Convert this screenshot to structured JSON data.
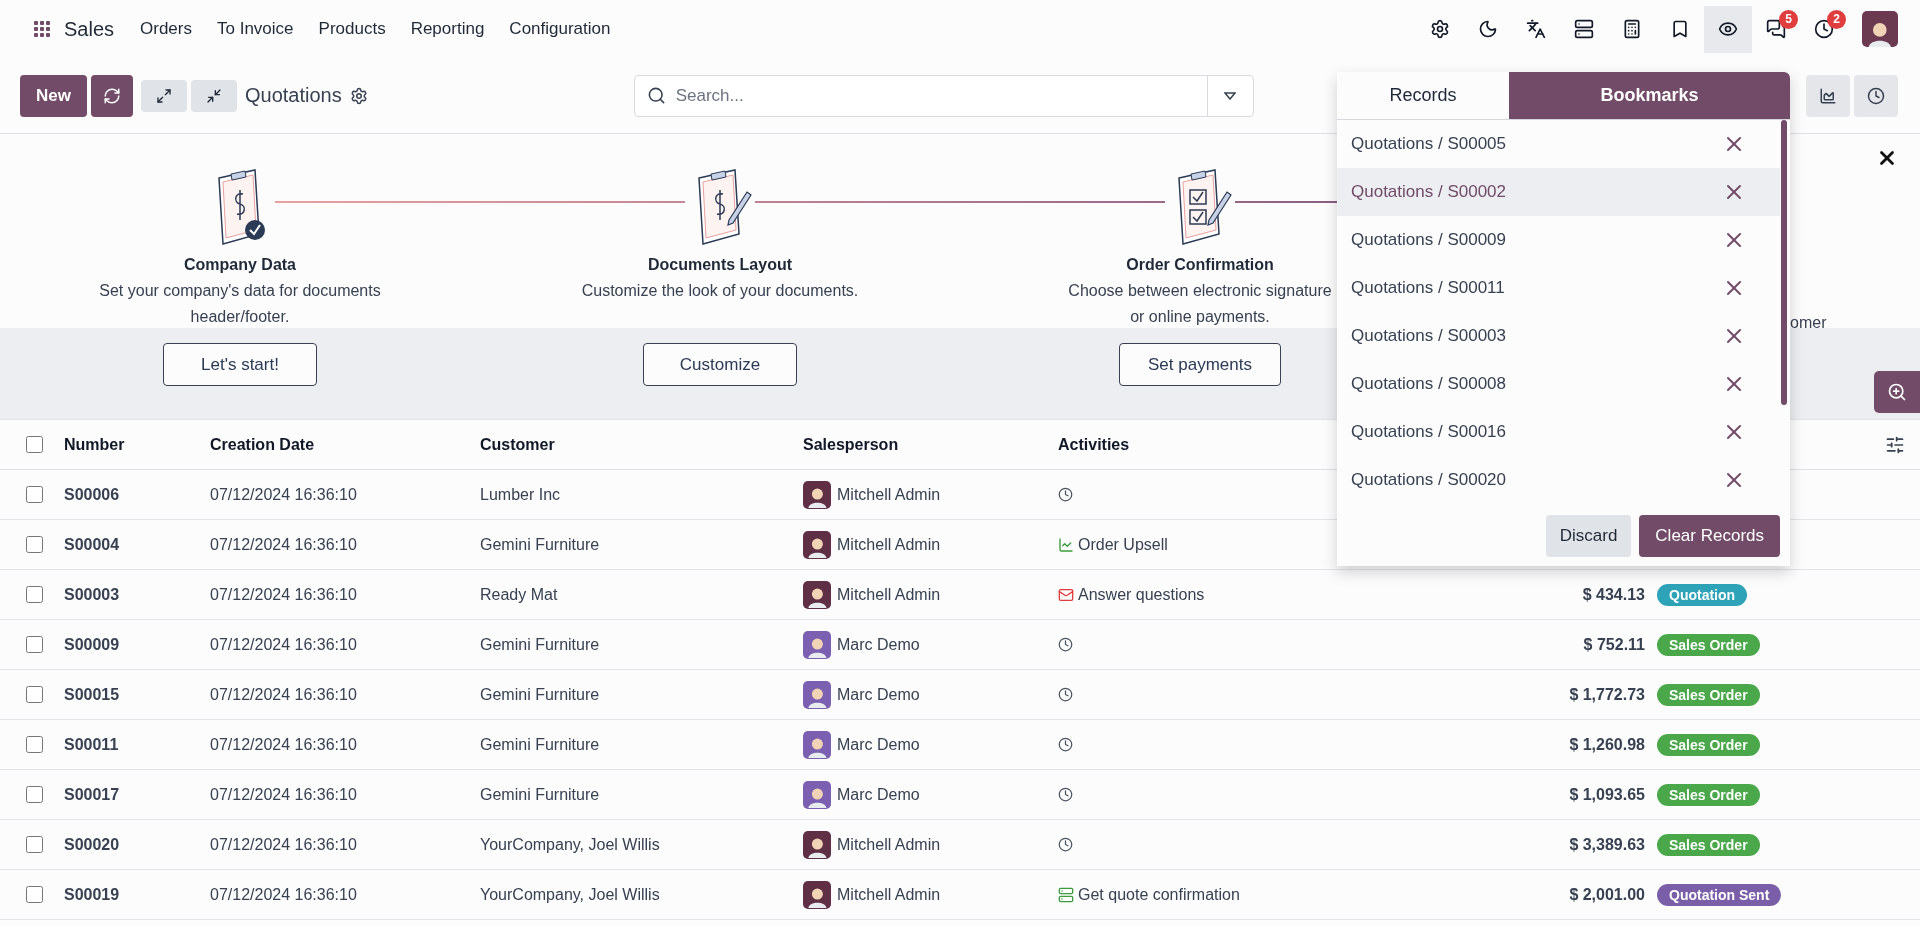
{
  "navbar": {
    "app": "Sales",
    "menu": [
      "Orders",
      "To Invoice",
      "Products",
      "Reporting",
      "Configuration"
    ],
    "systray": [
      {
        "kind": "settings",
        "active": false
      },
      {
        "kind": "theme",
        "active": false
      },
      {
        "kind": "translate",
        "active": false
      },
      {
        "kind": "stack",
        "active": false
      },
      {
        "kind": "calculator",
        "active": false
      },
      {
        "kind": "bookmark",
        "active": false
      },
      {
        "kind": "eye",
        "active": true
      },
      {
        "kind": "chat",
        "active": false,
        "badge": "5"
      },
      {
        "kind": "activity",
        "active": false,
        "badge": "2"
      }
    ]
  },
  "control_panel": {
    "new_button": "New",
    "title": "Quotations",
    "search": {
      "placeholder": "Search..."
    }
  },
  "onboarding": {
    "steps": [
      {
        "title": "Company Data",
        "description": [
          "Set your company's data for documents",
          "header/footer."
        ],
        "button": "Let's start!"
      },
      {
        "title": "Documents Layout",
        "description": [
          "Customize the look of your documents."
        ],
        "button": "Customize"
      },
      {
        "title": "Order Confirmation",
        "description": [
          "Choose between electronic signature",
          "or online payments."
        ],
        "button": "Set payments"
      }
    ],
    "hidden_step_text": "omer"
  },
  "table": {
    "select_all": {
      "checked": false
    },
    "columns": [
      "Number",
      "Creation Date",
      "Customer",
      "Salesperson",
      "Activities"
    ],
    "rows": [
      {
        "checked": false,
        "number": "S00006",
        "date": "07/12/2024 16:36:10",
        "customer": "Lumber Inc",
        "salesperson": {
          "name": "Mitchell Admin",
          "color": "#5e2f45"
        },
        "activity": {
          "kind": "none"
        }
      },
      {
        "checked": false,
        "number": "S00004",
        "date": "07/12/2024 16:36:10",
        "customer": "Gemini Furniture",
        "salesperson": {
          "name": "Mitchell Admin",
          "color": "#5e2f45"
        },
        "activity": {
          "kind": "upsell",
          "label": "Order Upsell"
        }
      },
      {
        "checked": false,
        "number": "S00003",
        "date": "07/12/2024 16:36:10",
        "customer": "Ready Mat",
        "salesperson": {
          "name": "Mitchell Admin",
          "color": "#5e2f45"
        },
        "activity": {
          "kind": "email",
          "label": "Answer questions"
        },
        "total": "$ 434.13",
        "status": {
          "label": "Quotation",
          "color": "#2ea3b8"
        }
      },
      {
        "checked": false,
        "number": "S00009",
        "date": "07/12/2024 16:36:10",
        "customer": "Gemini Furniture",
        "salesperson": {
          "name": "Marc Demo",
          "color": "#7b5fb0"
        },
        "activity": {
          "kind": "none"
        },
        "total": "$ 752.11",
        "status": {
          "label": "Sales Order",
          "color": "#4aa84a"
        }
      },
      {
        "checked": false,
        "number": "S00015",
        "date": "07/12/2024 16:36:10",
        "customer": "Gemini Furniture",
        "salesperson": {
          "name": "Marc Demo",
          "color": "#7b5fb0"
        },
        "activity": {
          "kind": "none"
        },
        "total": "$ 1,772.73",
        "status": {
          "label": "Sales Order",
          "color": "#4aa84a"
        }
      },
      {
        "checked": false,
        "number": "S00011",
        "date": "07/12/2024 16:36:10",
        "customer": "Gemini Furniture",
        "salesperson": {
          "name": "Marc Demo",
          "color": "#7b5fb0"
        },
        "activity": {
          "kind": "none"
        },
        "total": "$ 1,260.98",
        "status": {
          "label": "Sales Order",
          "color": "#4aa84a"
        }
      },
      {
        "checked": false,
        "number": "S00017",
        "date": "07/12/2024 16:36:10",
        "customer": "Gemini Furniture",
        "salesperson": {
          "name": "Marc Demo",
          "color": "#7b5fb0"
        },
        "activity": {
          "kind": "none"
        },
        "total": "$ 1,093.65",
        "status": {
          "label": "Sales Order",
          "color": "#4aa84a"
        }
      },
      {
        "checked": false,
        "number": "S00020",
        "date": "07/12/2024 16:36:10",
        "customer": "YourCompany, Joel Willis",
        "salesperson": {
          "name": "Mitchell Admin",
          "color": "#5e2f45"
        },
        "activity": {
          "kind": "none"
        },
        "total": "$ 3,389.63",
        "status": {
          "label": "Sales Order",
          "color": "#4aa84a"
        }
      },
      {
        "checked": false,
        "number": "S00019",
        "date": "07/12/2024 16:36:10",
        "customer": "YourCompany, Joel Willis",
        "salesperson": {
          "name": "Mitchell Admin",
          "color": "#5e2f45"
        },
        "activity": {
          "kind": "todo",
          "label": "Get quote confirmation"
        },
        "total": "$ 2,001.00",
        "status": {
          "label": "Quotation Sent",
          "color": "#7a5fa8"
        }
      }
    ]
  },
  "popover": {
    "tabs": [
      {
        "label": "Records",
        "selected": false
      },
      {
        "label": "Bookmarks",
        "selected": true
      }
    ],
    "items": [
      {
        "label": "Quotations / S00005",
        "selected": false
      },
      {
        "label": "Quotations / S00002",
        "selected": true
      },
      {
        "label": "Quotations / S00009",
        "selected": false
      },
      {
        "label": "Quotations / S00011",
        "selected": false
      },
      {
        "label": "Quotations / S00003",
        "selected": false
      },
      {
        "label": "Quotations / S00008",
        "selected": false
      },
      {
        "label": "Quotations / S00016",
        "selected": false
      },
      {
        "label": "Quotations / S00020",
        "selected": false
      }
    ],
    "buttons": [
      "Discard",
      "Clear Records"
    ]
  }
}
